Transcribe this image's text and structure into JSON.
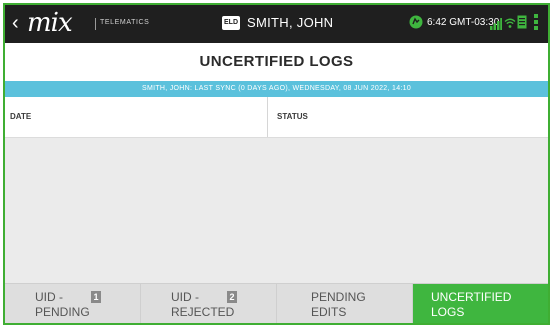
{
  "topbar": {
    "back_glyph": "‹",
    "logo": "mix",
    "logo_sub": "TELEMATICS",
    "eld_badge": "ELD",
    "driver_name": "SMITH, JOHN",
    "status_icon": "driver-status-icon",
    "clock": "6:42 GMT-03:30",
    "signal_icon": "signal-bars-icon",
    "wifi_icon": "wifi-icon",
    "doc_icon": "document-icon",
    "menu_icon": "more-vert-icon",
    "colors": {
      "background": "#1f1f1f",
      "status_green": "#3fb63f"
    }
  },
  "page": {
    "title": "UNCERTIFIED LOGS",
    "sync_text": "SMITH, JOHN: LAST SYNC (0 DAYS AGO), WEDNESDAY, 08 JUN 2022, 14:10",
    "sync_color": "#5bc1dc"
  },
  "table": {
    "columns": [
      "DATE",
      "STATUS"
    ],
    "rows": []
  },
  "tabs": [
    {
      "line1": "UID -",
      "line2": "PENDING",
      "badge": "1",
      "active": false
    },
    {
      "line1": "UID -",
      "line2": "REJECTED",
      "badge": "2",
      "active": false
    },
    {
      "line1": "PENDING",
      "line2": "EDITS",
      "badge": "",
      "active": false
    },
    {
      "line1": "UNCERTIFIED",
      "line2": "LOGS",
      "badge": "",
      "active": true
    }
  ],
  "accent_color": "#3fb63f"
}
